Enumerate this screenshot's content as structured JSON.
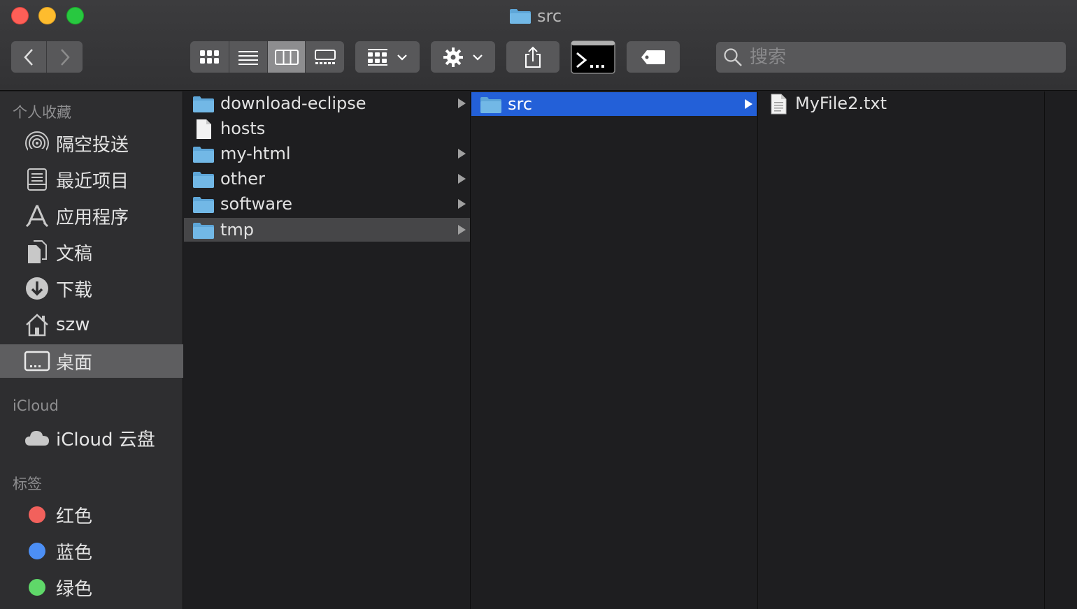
{
  "window": {
    "title": "src"
  },
  "toolbar": {
    "back_label": "back",
    "forward_label": "forward",
    "views": [
      "icon-view",
      "list-view",
      "column-view",
      "gallery-view"
    ],
    "active_view_index": 2
  },
  "search": {
    "placeholder": "搜索",
    "value": ""
  },
  "sidebar": {
    "favorites_title": "个人收藏",
    "favorites": [
      {
        "label": "隔空投送",
        "icon": "airdrop-icon"
      },
      {
        "label": "最近项目",
        "icon": "recents-icon"
      },
      {
        "label": "应用程序",
        "icon": "applications-icon"
      },
      {
        "label": "文稿",
        "icon": "documents-icon"
      },
      {
        "label": "下载",
        "icon": "downloads-icon"
      },
      {
        "label": "szw",
        "icon": "home-icon"
      },
      {
        "label": "桌面",
        "icon": "desktop-icon",
        "selected": true
      }
    ],
    "icloud_title": "iCloud",
    "icloud": [
      {
        "label": "iCloud 云盘",
        "icon": "cloud-icon"
      }
    ],
    "tags_title": "标签",
    "tags": [
      {
        "label": "红色",
        "color": "#f2615c"
      },
      {
        "label": "蓝色",
        "color": "#4c8ff5"
      },
      {
        "label": "绿色",
        "color": "#5fd869"
      }
    ]
  },
  "columns": [
    {
      "items": [
        {
          "name": "download-eclipse",
          "type": "folder",
          "has_children": true
        },
        {
          "name": "hosts",
          "type": "file",
          "has_children": false
        },
        {
          "name": "my-html",
          "type": "folder",
          "has_children": true
        },
        {
          "name": "other",
          "type": "folder",
          "has_children": true
        },
        {
          "name": "software",
          "type": "folder",
          "has_children": true
        },
        {
          "name": "tmp",
          "type": "folder",
          "has_children": true,
          "selected": "inactive"
        }
      ]
    },
    {
      "items": [
        {
          "name": "src",
          "type": "folder",
          "has_children": true,
          "selected": "active"
        }
      ]
    },
    {
      "items": [
        {
          "name": "MyFile2.txt",
          "type": "text-file",
          "has_children": false
        }
      ]
    }
  ]
}
